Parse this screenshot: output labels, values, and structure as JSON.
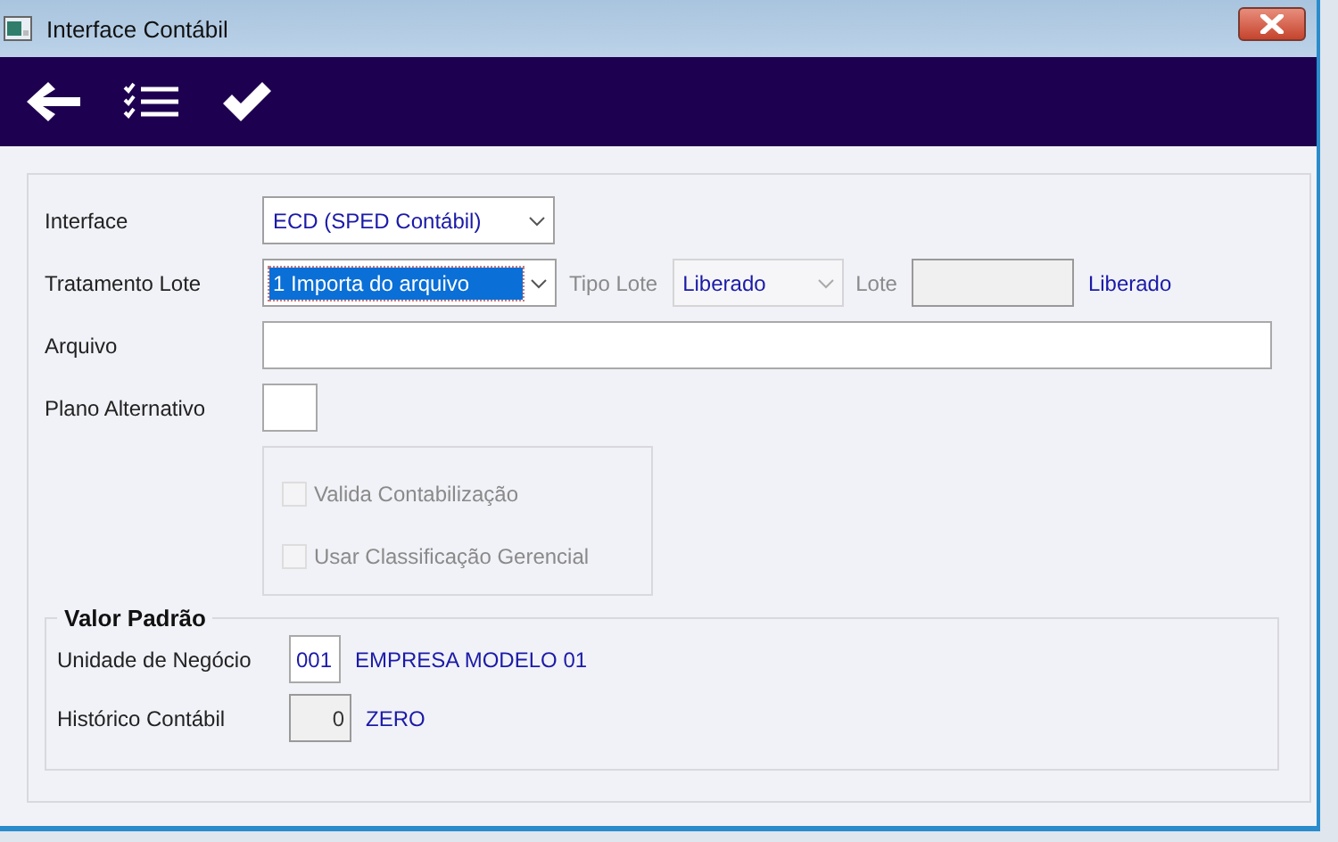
{
  "window": {
    "title": "Interface Contábil"
  },
  "toolbar": [
    {
      "kind": "back"
    },
    {
      "kind": "checklist"
    },
    {
      "kind": "confirm"
    }
  ],
  "interface": {
    "label": "Interface",
    "value": "ECD (SPED Contábil)"
  },
  "tratamento_lote": {
    "label": "Tratamento Lote",
    "value": "1 Importa do arquivo",
    "focused": true
  },
  "tipo_lote": {
    "label": "Tipo Lote",
    "value": "Liberado",
    "disabled": true
  },
  "lote": {
    "label": "Lote",
    "disabled": true,
    "description": "Liberado"
  },
  "arquivo": {
    "label": "Arquivo"
  },
  "plano_alternativo": {
    "label": "Plano Alternativo"
  },
  "options": [
    {
      "label": "Valida Contabilização",
      "checked": false,
      "disabled": true
    },
    {
      "label": "Usar Classificação Gerencial",
      "checked": false,
      "disabled": true
    }
  ],
  "valor_padrao": {
    "title": "Valor Padrão",
    "unidade": {
      "label": "Unidade de Negócio",
      "value": "001",
      "description": "EMPRESA MODELO 01",
      "disabled": false
    },
    "historico": {
      "label": "Histórico Contábil",
      "value": "0",
      "description": "ZERO",
      "disabled": true
    }
  }
}
